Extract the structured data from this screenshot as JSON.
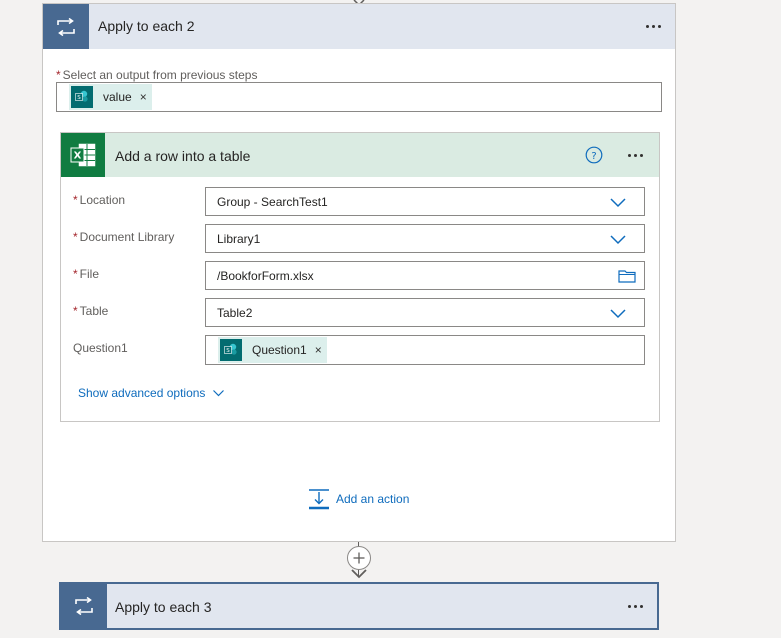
{
  "outer_loop": {
    "title": "Apply to each 2",
    "select_output_label": "Select an output from previous steps",
    "output_token": {
      "label": "value",
      "remove": "×"
    }
  },
  "excel_action": {
    "title": "Add a row into a table",
    "fields": {
      "location": {
        "label": "Location",
        "value": "Group - SearchTest1"
      },
      "library": {
        "label": "Document Library",
        "value": "Library1"
      },
      "file": {
        "label": "File",
        "value": "/BookforForm.xlsx"
      },
      "table": {
        "label": "Table",
        "value": "Table2"
      },
      "question1": {
        "label": "Question1",
        "token": "Question1",
        "remove": "×"
      }
    },
    "show_advanced": "Show advanced options"
  },
  "add_action": {
    "label": "Add an action"
  },
  "next_loop": {
    "title": "Apply to each 3"
  },
  "colors": {
    "loop_accent": "#486991",
    "excel_accent": "#107c41",
    "sharepoint_accent": "#036c70",
    "link": "#0f6cbd",
    "required": "#a4262c"
  },
  "icons": {
    "loop": "loop-arrows-icon",
    "excel": "excel-icon",
    "sharepoint": "sharepoint-icon",
    "more": "more-options-icon",
    "help": "help-icon",
    "chevron": "chevron-down-icon",
    "folder": "folder-icon",
    "add_action": "add-action-icon",
    "plus": "plus-icon"
  }
}
